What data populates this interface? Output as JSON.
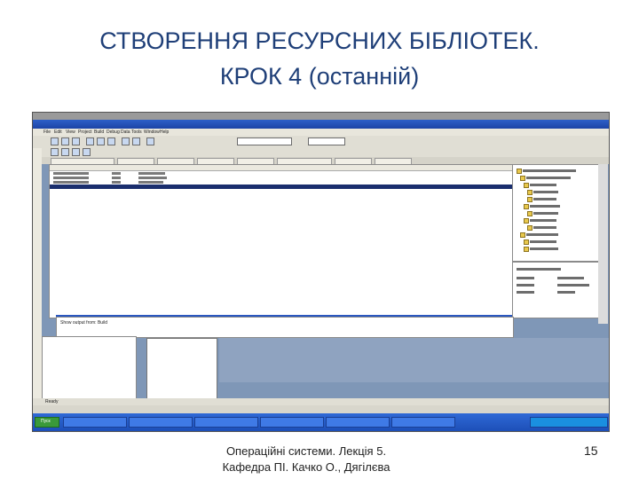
{
  "slide": {
    "title_line1": "СТВОРЕННЯ РЕСУРСНИХ БІБЛІОТЕК.",
    "title_line2": "КРОК 4 (останній)",
    "footer_line1": "Операційні системи. Лекція 5.",
    "footer_line2": "Кафедра ПІ. Качко О., Дягілєва",
    "page_number": "15"
  },
  "screenshot": {
    "menu_items": [
      "File",
      "Edit",
      "View",
      "Project",
      "Build",
      "Debug",
      "Data",
      "Tools",
      "Window",
      "Help"
    ],
    "output_label": "Show output from: Build",
    "taskbar_start": "Пуск",
    "status_text": "Ready"
  },
  "colors": {
    "title": "#1f3f78",
    "window_title": "#2d5fc8",
    "desktop": "#7f97b7",
    "taskbar": "#2f69d6"
  }
}
